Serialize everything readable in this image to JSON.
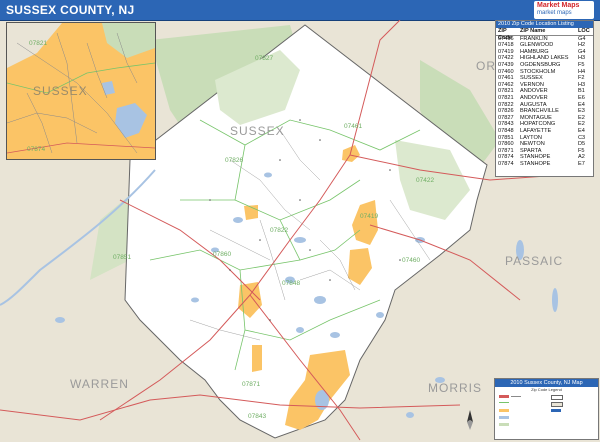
{
  "title": "SUSSEX COUNTY, NJ",
  "logo": {
    "line1": "Market Maps",
    "line2": "market maps"
  },
  "map": {
    "county_label": "SUSSEX",
    "neighbor_labels": {
      "warren": "WARREN",
      "morris": "MORRIS",
      "passaic": "PASSAIC",
      "orange_partial": "OR"
    },
    "zip_labels": [
      "07827",
      "07461",
      "07826",
      "07422",
      "07419",
      "07822",
      "07460",
      "07851",
      "07860",
      "07848",
      "07871",
      "07843"
    ],
    "colors": {
      "background": "#e9e4d6",
      "county_fill": "#ffffff",
      "urban": "#fbc466",
      "water": "#a8c3e3",
      "forest": "#c9ddb8",
      "road_major": "#d45a5a",
      "road_minor": "#8a8a8a",
      "zip_border": "#77c46a",
      "title_bar": "#2c66b5"
    }
  },
  "inset": {
    "county_label": "SUSSEX",
    "zip_labels": [
      "07821",
      "07874"
    ]
  },
  "zip_table": {
    "header": "2010 Zip Code Location Listing",
    "columns": [
      "ZIP Code",
      "ZIP Name",
      "LOC"
    ],
    "rows": [
      [
        "07416",
        "FRANKLIN",
        "G4"
      ],
      [
        "07418",
        "GLENWOOD",
        "H2"
      ],
      [
        "07419",
        "HAMBURG",
        "G4"
      ],
      [
        "07422",
        "HIGHLAND LAKES",
        "H3"
      ],
      [
        "07439",
        "OGDENSBURG",
        "F5"
      ],
      [
        "07460",
        "STOCKHOLM",
        "H4"
      ],
      [
        "07461",
        "SUSSEX",
        "F2"
      ],
      [
        "07462",
        "VERNON",
        "H3"
      ],
      [
        "07821",
        "ANDOVER",
        "B1"
      ],
      [
        "07821",
        "ANDOVER",
        "E6"
      ],
      [
        "07822",
        "AUGUSTA",
        "E4"
      ],
      [
        "07826",
        "BRANCHVILLE",
        "E3"
      ],
      [
        "07827",
        "MONTAGUE",
        "E2"
      ],
      [
        "07843",
        "HOPATCONG",
        "E2"
      ],
      [
        "07848",
        "LAFAYETTE",
        "E4"
      ],
      [
        "07851",
        "LAYTON",
        "C3"
      ],
      [
        "07860",
        "NEWTON",
        "D5"
      ],
      [
        "07871",
        "SPARTA",
        "F5"
      ],
      [
        "07874",
        "STANHOPE",
        "A2"
      ],
      [
        "07874",
        "STANHOPE",
        "E7"
      ]
    ]
  },
  "legend": {
    "title": "2010 Sussex County, NJ Map",
    "subtitle": "Zip Code Legend"
  }
}
